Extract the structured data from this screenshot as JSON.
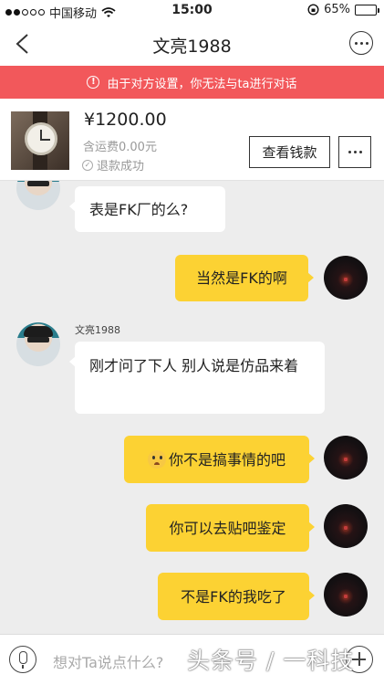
{
  "status_bar": {
    "carrier": "中国移动",
    "time": "15:00",
    "battery": "65%",
    "battery_level": 0.65
  },
  "nav": {
    "title": "文亮1988"
  },
  "banner": {
    "text": "由于对方设置，你无法与ta进行对话"
  },
  "product": {
    "price": "¥1200.00",
    "shipping": "含运费0.00元",
    "status": "退款成功",
    "view_button": "查看钱款"
  },
  "messages": [
    {
      "side": "them",
      "text": "表是FK厂的么?"
    },
    {
      "side": "me",
      "text": "当然是FK的啊"
    },
    {
      "side": "them",
      "sender": "文亮1988",
      "text": "刚才问了下人 别人说是仿品来着"
    },
    {
      "side": "me",
      "emoji": "flushed-emoji",
      "text": "你不是搞事情的吧"
    },
    {
      "side": "me",
      "text": "你可以去贴吧鉴定"
    },
    {
      "side": "me",
      "text": "不是FK的我吃了"
    }
  ],
  "input": {
    "placeholder": "想对Ta说点什么?"
  },
  "watermark": "头条号 / 一科技"
}
